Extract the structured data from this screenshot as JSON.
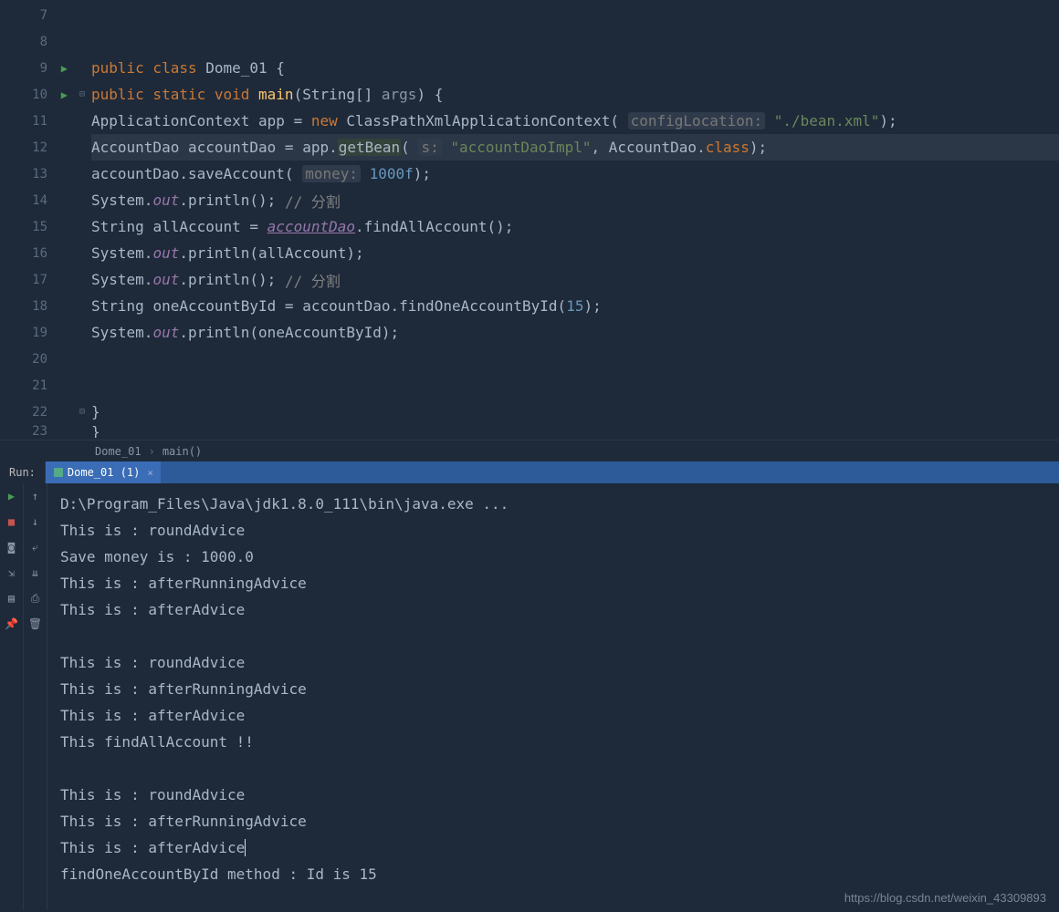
{
  "editor": {
    "lines": [
      {
        "num": 7,
        "run": false,
        "fold": "",
        "tokens": []
      },
      {
        "num": 8,
        "run": false,
        "fold": "",
        "tokens": []
      },
      {
        "num": 9,
        "run": true,
        "fold": "",
        "indent": "",
        "tokens": [
          {
            "t": "kw",
            "v": "public class "
          },
          {
            "t": "cls",
            "v": "Dome_01 "
          },
          {
            "t": "id",
            "v": "{"
          }
        ]
      },
      {
        "num": 10,
        "run": true,
        "fold": "⊟",
        "indent": "    ",
        "tokens": [
          {
            "t": "kw",
            "v": "public static void "
          },
          {
            "t": "mth",
            "v": "main"
          },
          {
            "t": "id",
            "v": "("
          },
          {
            "t": "cls",
            "v": "String"
          },
          {
            "t": "id",
            "v": "[] "
          },
          {
            "t": "par",
            "v": "args"
          },
          {
            "t": "id",
            "v": ") {"
          }
        ]
      },
      {
        "num": 11,
        "run": false,
        "fold": "",
        "indent": "        ",
        "tokens": [
          {
            "t": "cls",
            "v": "ApplicationContext "
          },
          {
            "t": "id",
            "v": "app = "
          },
          {
            "t": "kw",
            "v": "new "
          },
          {
            "t": "cls",
            "v": "ClassPathXmlApplicationContext"
          },
          {
            "t": "id",
            "v": "( "
          },
          {
            "t": "hint",
            "v": "configLocation:"
          },
          {
            "t": "id",
            "v": " "
          },
          {
            "t": "str",
            "v": "\"./bean.xml\""
          },
          {
            "t": "id",
            "v": ");"
          }
        ]
      },
      {
        "num": 12,
        "run": false,
        "fold": "",
        "hl": true,
        "indent": "        ",
        "tokens": [
          {
            "t": "cls",
            "v": "AccountDao "
          },
          {
            "t": "id",
            "v": "accountDao = app."
          },
          {
            "t": "mthcall",
            "v": "getBean"
          },
          {
            "t": "id",
            "v": "( "
          },
          {
            "t": "hint",
            "v": "s:"
          },
          {
            "t": "id",
            "v": " "
          },
          {
            "t": "str",
            "v": "\"accountDaoImpl\""
          },
          {
            "t": "id",
            "v": ", "
          },
          {
            "t": "cls",
            "v": "AccountDao"
          },
          {
            "t": "id",
            "v": "."
          },
          {
            "t": "kw",
            "v": "class"
          },
          {
            "t": "id",
            "v": ");"
          }
        ]
      },
      {
        "num": 13,
        "run": false,
        "fold": "",
        "indent": "        ",
        "tokens": [
          {
            "t": "id",
            "v": "accountDao.saveAccount( "
          },
          {
            "t": "hint",
            "v": "money:"
          },
          {
            "t": "id",
            "v": " "
          },
          {
            "t": "num",
            "v": "1000f"
          },
          {
            "t": "id",
            "v": ");"
          }
        ]
      },
      {
        "num": 14,
        "run": false,
        "fold": "",
        "indent": "        ",
        "tokens": [
          {
            "t": "cls",
            "v": "System"
          },
          {
            "t": "id",
            "v": "."
          },
          {
            "t": "fld",
            "v": "out"
          },
          {
            "t": "id",
            "v": ".println(); "
          },
          {
            "t": "cmt",
            "v": "// 分割"
          }
        ]
      },
      {
        "num": 15,
        "run": false,
        "fold": "",
        "indent": "        ",
        "tokens": [
          {
            "t": "cls",
            "v": "String "
          },
          {
            "t": "id",
            "v": "allAccount = "
          },
          {
            "t": "fld under",
            "v": "accountDao"
          },
          {
            "t": "id",
            "v": ".findAllAccount();"
          }
        ]
      },
      {
        "num": 16,
        "run": false,
        "fold": "",
        "indent": "        ",
        "tokens": [
          {
            "t": "cls",
            "v": "System"
          },
          {
            "t": "id",
            "v": "."
          },
          {
            "t": "fld",
            "v": "out"
          },
          {
            "t": "id",
            "v": ".println("
          },
          {
            "t": "id",
            "v": "allAccount"
          },
          {
            "t": "id",
            "v": ");"
          }
        ]
      },
      {
        "num": 17,
        "run": false,
        "fold": "",
        "indent": "        ",
        "tokens": [
          {
            "t": "cls",
            "v": "System"
          },
          {
            "t": "id",
            "v": "."
          },
          {
            "t": "fld",
            "v": "out"
          },
          {
            "t": "id",
            "v": ".println(); "
          },
          {
            "t": "cmt",
            "v": "// 分割"
          }
        ]
      },
      {
        "num": 18,
        "run": false,
        "fold": "",
        "indent": "        ",
        "tokens": [
          {
            "t": "cls",
            "v": "String "
          },
          {
            "t": "id",
            "v": "oneAccountById = accountDao.findOneAccountById("
          },
          {
            "t": "num",
            "v": "15"
          },
          {
            "t": "id",
            "v": ");"
          }
        ]
      },
      {
        "num": 19,
        "run": false,
        "fold": "",
        "indent": "        ",
        "tokens": [
          {
            "t": "cls",
            "v": "System"
          },
          {
            "t": "id",
            "v": "."
          },
          {
            "t": "fld",
            "v": "out"
          },
          {
            "t": "id",
            "v": ".println("
          },
          {
            "t": "id",
            "v": "oneAccountById"
          },
          {
            "t": "id",
            "v": ");"
          }
        ]
      },
      {
        "num": 20,
        "run": false,
        "fold": "",
        "tokens": []
      },
      {
        "num": 21,
        "run": false,
        "fold": "",
        "tokens": []
      },
      {
        "num": 22,
        "run": false,
        "fold": "⊟",
        "indent": "    ",
        "tokens": [
          {
            "t": "id",
            "v": "}"
          }
        ]
      },
      {
        "num": 23,
        "run": false,
        "fold": "",
        "indent": "",
        "tokens": [
          {
            "t": "id",
            "v": "}"
          }
        ],
        "partial": true
      }
    ]
  },
  "breadcrumb": {
    "items": [
      "Dome_01",
      "main()"
    ]
  },
  "runPanel": {
    "label": "Run:",
    "tabLabel": "Dome_01 (1)"
  },
  "console": {
    "lines": [
      "D:\\Program_Files\\Java\\jdk1.8.0_111\\bin\\java.exe ...",
      "This is : roundAdvice",
      "Save money is : 1000.0",
      "This is : afterRunningAdvice",
      "This is : afterAdvice",
      "",
      "This is : roundAdvice",
      "This is : afterRunningAdvice",
      "This is : afterAdvice",
      "This findAllAccount !!",
      "",
      "This is : roundAdvice",
      "This is : afterRunningAdvice",
      "This is : afterAdvice",
      "findOneAccountById method : Id is 15"
    ],
    "caretLine": 13
  },
  "watermark": "https://blog.csdn.net/weixin_43309893"
}
